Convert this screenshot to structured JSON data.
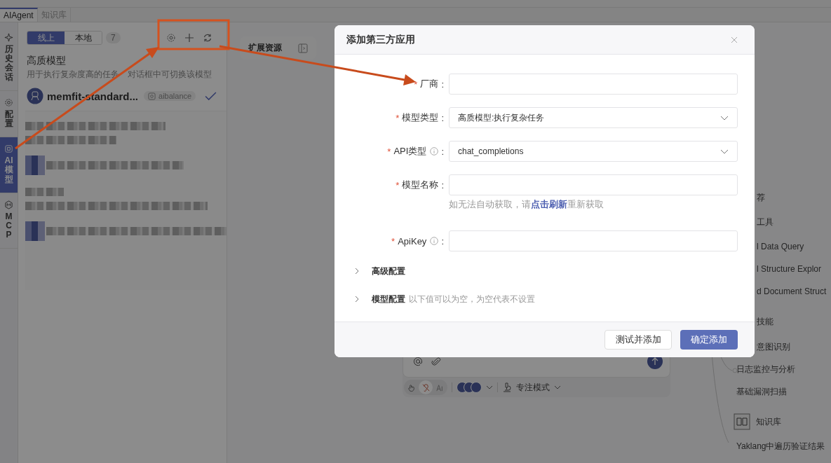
{
  "top_tabs": [
    {
      "label": "AIAgent",
      "selected": true
    },
    {
      "label": "知识库",
      "selected": false
    }
  ],
  "side_nav": [
    {
      "label": "历史会话",
      "selected": false
    },
    {
      "label": "配置",
      "selected": false
    },
    {
      "label": "AI模型",
      "selected": true
    },
    {
      "label": "MCP",
      "selected": false
    }
  ],
  "model_panel": {
    "source_tabs": [
      {
        "label": "线上",
        "selected": true
      },
      {
        "label": "本地",
        "selected": false
      }
    ],
    "count": "7",
    "title": "高质模型",
    "description": "用于执行复杂度高的任务　对话框中可切换该模型",
    "models": [
      {
        "name": "memfit-standard...",
        "provider": "aibalance",
        "selected": true
      }
    ]
  },
  "extension_card": {
    "label": "扩展资源"
  },
  "chat_input": {
    "mode_toggles": [
      {
        "selected": false
      },
      {
        "selected": true
      },
      {
        "selected": false
      }
    ],
    "focus_mode": "专注模式"
  },
  "mindmap": {
    "nodes": [
      {
        "label": "荐",
        "kind": "category"
      },
      {
        "label": "工具",
        "kind": "category"
      },
      {
        "label": "l Data Query",
        "kind": "item"
      },
      {
        "label": "l Structure Explor",
        "kind": "item"
      },
      {
        "label": "d Document Struct",
        "kind": "item"
      },
      {
        "label": "技能",
        "kind": "category"
      },
      {
        "label": "意图识别",
        "kind": "item"
      },
      {
        "label": "日志监控与分析",
        "kind": "item"
      },
      {
        "label": "基础漏洞扫描",
        "kind": "item"
      },
      {
        "label": "知识库",
        "kind": "library"
      },
      {
        "label": "Yaklang中遍历验证结果",
        "kind": "item"
      }
    ]
  },
  "dialog": {
    "title": "添加第三方应用",
    "fields": [
      {
        "label": "厂商",
        "suffix": ":",
        "required_mark": "*",
        "kind": "input"
      },
      {
        "label": "模型类型",
        "suffix": ":",
        "required_mark": "*",
        "kind": "select",
        "value": "高质模型:执行复杂任务"
      },
      {
        "label": "API类型",
        "suffix": ":",
        "required_mark": "*",
        "info": true,
        "kind": "select",
        "value": "chat_completions"
      },
      {
        "label": "模型名称",
        "suffix": ":",
        "required_mark": "*",
        "kind": "input",
        "hint": {
          "before": "如无法自动获取，请",
          "link": "点击刷新",
          "after": "重新获取"
        }
      },
      {
        "label": "ApiKey",
        "suffix": ":",
        "required_mark": "*",
        "info": true,
        "kind": "input"
      }
    ],
    "sections": [
      {
        "label": "高级配置",
        "expanded": false
      },
      {
        "label": "模型配置",
        "note": "以下值可以为空，为空代表不设置",
        "expanded": false
      }
    ],
    "buttons": [
      {
        "label": "测试并添加",
        "kind": "default"
      },
      {
        "label": "确定添加",
        "kind": "primary"
      }
    ]
  }
}
